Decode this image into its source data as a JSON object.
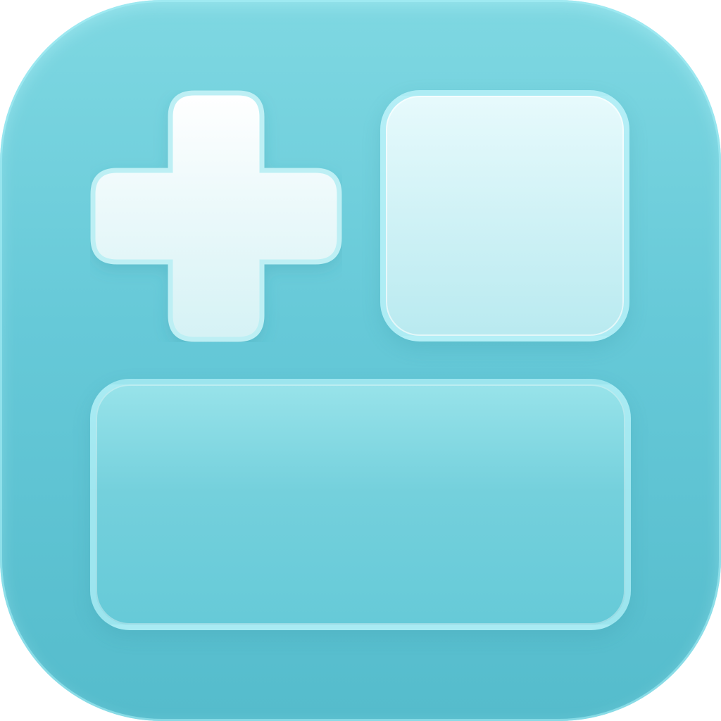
{
  "icon": {
    "name": "widget-add-app-icon",
    "colors": {
      "background_top": "#7fd8e2",
      "background_bottom": "#55bccc",
      "plus_fill": "#f6fdfe",
      "square_fill": "#d4f3f6",
      "wide_fill": "#74d0dc",
      "tile_border": "#aaecf4"
    },
    "glyphs": [
      "plus-icon",
      "square-widget-tile",
      "wide-widget-tile"
    ]
  }
}
